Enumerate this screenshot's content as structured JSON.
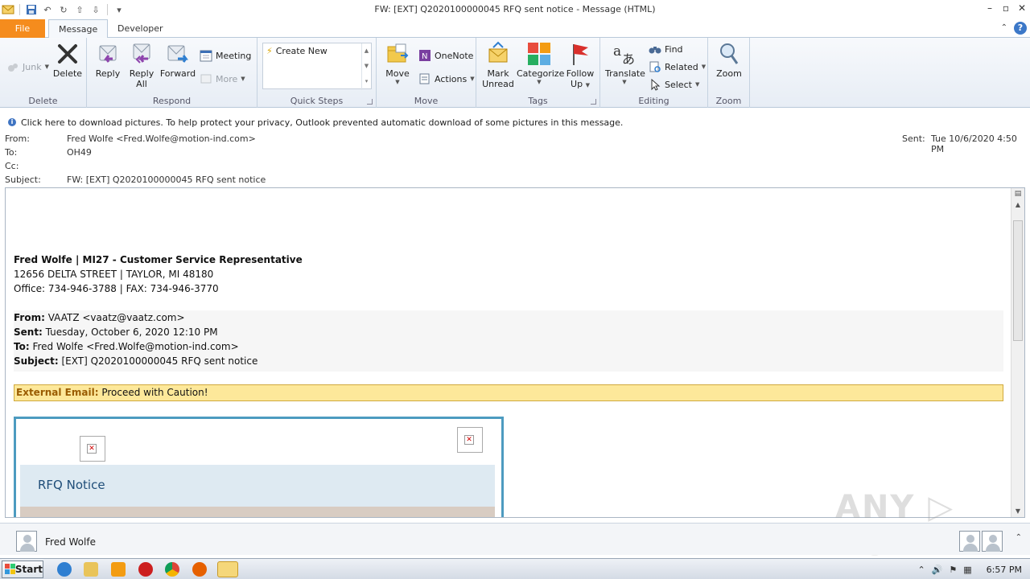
{
  "window": {
    "title": "FW: [EXT] Q2020100000045 RFQ sent notice - Message (HTML)"
  },
  "tabs": {
    "file": "File",
    "message": "Message",
    "developer": "Developer"
  },
  "ribbon": {
    "delete_group": {
      "label": "Delete",
      "junk": "Junk",
      "delete": "Delete"
    },
    "respond_group": {
      "label": "Respond",
      "reply": "Reply",
      "reply_all_1": "Reply",
      "reply_all_2": "All",
      "forward": "Forward",
      "meeting": "Meeting",
      "more": "More"
    },
    "quicksteps_group": {
      "label": "Quick Steps",
      "create_new": "Create New"
    },
    "move_group": {
      "label": "Move",
      "move": "Move",
      "onenote": "OneNote",
      "actions": "Actions"
    },
    "tags_group": {
      "label": "Tags",
      "mark_unread_1": "Mark",
      "mark_unread_2": "Unread",
      "categorize": "Categorize",
      "follow_up_1": "Follow",
      "follow_up_2": "Up"
    },
    "editing_group": {
      "label": "Editing",
      "translate": "Translate",
      "find": "Find",
      "related": "Related",
      "select": "Select"
    },
    "zoom_group": {
      "label": "Zoom",
      "zoom": "Zoom"
    }
  },
  "infobar": {
    "text": "Click here to download pictures. To help protect your privacy, Outlook prevented automatic download of some pictures in this message."
  },
  "headers": {
    "from_label": "From:",
    "from_value": "Fred Wolfe <Fred.Wolfe@motion-ind.com>",
    "to_label": "To:",
    "to_value": "OH49",
    "cc_label": "Cc:",
    "subject_label": "Subject:",
    "subject_value": "FW: [EXT] Q2020100000045 RFQ sent notice",
    "sent_label": "Sent:",
    "sent_value": "Tue 10/6/2020 4:50 PM"
  },
  "message": {
    "signature_name": "Fred Wolfe | MI27 - Customer Service Representative",
    "signature_address": "12656 DELTA STREET | TAYLOR, MI 48180",
    "signature_phone": "Office: 734-946-3788 | FAX: 734-946-3770",
    "fwd_from_label": "From:",
    "fwd_from_value": " VAATZ <vaatz@vaatz.com>",
    "fwd_sent_label": "Sent:",
    "fwd_sent_value": " Tuesday, October 6, 2020 12:10 PM",
    "fwd_to_label": "To:",
    "fwd_to_value": " Fred Wolfe <Fred.Wolfe@motion-ind.com>",
    "fwd_subject_label": "Subject:",
    "fwd_subject_value": " [EXT] Q2020100000045 RFQ sent notice",
    "external_label": "External Email:",
    "external_text": " Proceed with Caution!",
    "rfq_title": "RFQ Notice"
  },
  "people_pane": {
    "name": "Fred Wolfe"
  },
  "taskbar": {
    "start": "Start",
    "clock": "6:57 PM"
  },
  "watermark": "ANY RUN",
  "colors": {
    "file_tab": "#f58c1d",
    "rfq_border": "#4d9bc0",
    "banner": "#fde89a"
  }
}
